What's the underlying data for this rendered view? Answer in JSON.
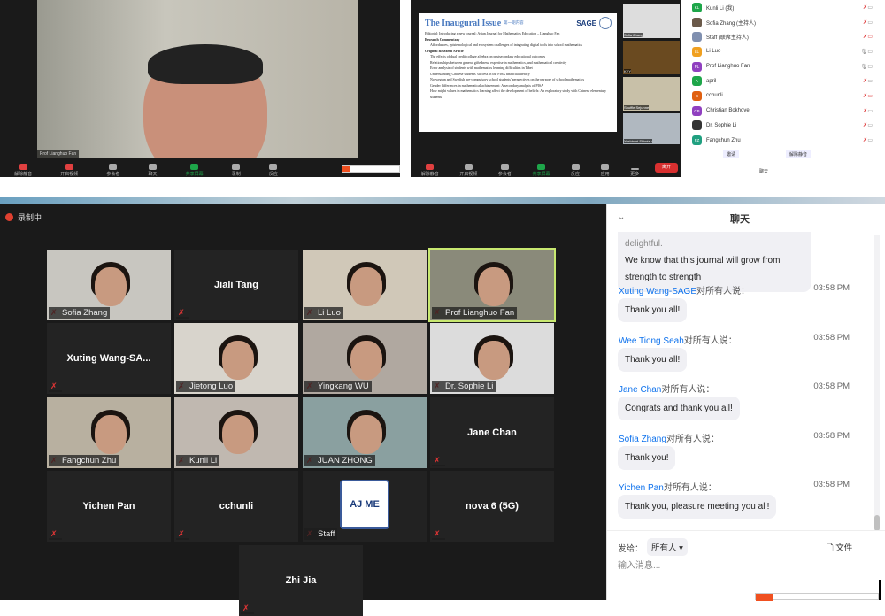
{
  "window1": {
    "speaker_label": "Prof Lianghuo Fan",
    "toolbar": [
      "解除静音",
      "开启视频",
      "参会者",
      "聊天",
      "共享屏幕",
      "录制",
      "反应"
    ],
    "participants_count": "10",
    "chat_badge": "1"
  },
  "window2": {
    "slide": {
      "title": "The Inaugural Issue",
      "title_cn": "第一期内容",
      "brand": "SAGE",
      "lines": [
        "Editorial: Introducing a new journal: Asian Journal for Mathematics Education – Lianghuo Fan",
        "Research Commentary",
        "Affordances, epistemological and ecosystem challenges of integrating digital tools into school mathematics",
        "Original Research Article",
        "The effects of dual credit college algebra on postsecondary educational outcomes",
        "Relationships between general giftedness, expertise in mathematics, and mathematical creativity",
        "Error analysis of students with mathematics learning difficulties in Tibet",
        "Understanding Chinese students' success in the PISA financial literacy",
        "Norwegian and Swedish pre-compulsory school students' perspectives on the purpose of school mathematics",
        "Gender differences in mathematical achievement: A secondary analysis of PISA",
        "How might values in mathematics learning affect the development of beliefs: An exploratory study with Chinese elementary students"
      ]
    },
    "thumbs": [
      "Sofia Zhang",
      "KYY",
      "Shuffle Sejunne",
      "Yoshinori Shimizu"
    ],
    "toolbar": [
      "解除静音",
      "开启视频",
      "参会者",
      "共享屏幕",
      "反应",
      "应用",
      "更多"
    ],
    "participants_count": "10",
    "leave_label": "离开",
    "participants": [
      {
        "initials": "KL",
        "name": "Kunli Li (我)",
        "color": "#1ea64a",
        "mic_muted": true,
        "cam_off": false
      },
      {
        "initials": "",
        "name": "Sofia Zhang (主持人)",
        "color": "#6b5a4a",
        "mic_muted": true,
        "cam_off": false
      },
      {
        "initials": "",
        "name": "Staff (联席主持人)",
        "color": "#8090b0",
        "mic_muted": true,
        "cam_off": true
      },
      {
        "initials": "LL",
        "name": "Li Luo",
        "color": "#f0a020",
        "mic_muted": false,
        "cam_off": false
      },
      {
        "initials": "PL",
        "name": "Prof Lianghuo Fan",
        "color": "#9040c0",
        "mic_muted": false,
        "cam_off": false
      },
      {
        "initials": "A",
        "name": "april",
        "color": "#1ea64a",
        "mic_muted": true,
        "cam_off": false
      },
      {
        "initials": "C",
        "name": "cchunli",
        "color": "#e06010",
        "mic_muted": true,
        "cam_off": true
      },
      {
        "initials": "CB",
        "name": "Christian Bokhove",
        "color": "#9040c0",
        "mic_muted": true,
        "cam_off": false
      },
      {
        "initials": "",
        "name": "Dr. Sophie Li",
        "color": "#333",
        "mic_muted": true,
        "cam_off": false
      },
      {
        "initials": "FZ",
        "name": "Fangchun Zhu",
        "color": "#20a080",
        "mic_muted": true,
        "cam_off": false
      }
    ],
    "invite_label": "邀请",
    "mute_all_label": "解除静音",
    "chat_section_label": "聊天"
  },
  "main": {
    "recording_label": "录制中",
    "tiles": [
      {
        "name": "Sofia Zhang",
        "video": true
      },
      {
        "name": "Jiali Tang",
        "video": false
      },
      {
        "name": "Li Luo",
        "video": true
      },
      {
        "name": "Prof Lianghuo Fan",
        "video": true,
        "active": true
      },
      {
        "name": "Xuting Wang-SA...",
        "video": false
      },
      {
        "name": "Jietong Luo",
        "video": true
      },
      {
        "name": "Yingkang WU",
        "video": true
      },
      {
        "name": "Dr. Sophie Li",
        "video": true
      },
      {
        "name": "Fangchun Zhu",
        "video": true
      },
      {
        "name": "Kunli  Li",
        "video": true
      },
      {
        "name": "JUAN  ZHONG",
        "video": true
      },
      {
        "name": "Jane Chan",
        "video": false
      },
      {
        "name": "Yichen Pan",
        "video": false
      },
      {
        "name": "cchunli",
        "video": false
      },
      {
        "name": "Staff",
        "video": true,
        "logo": "AJ ME"
      },
      {
        "name": "nova 6 (5G)",
        "video": false
      },
      {
        "name": "Zhi Jia",
        "video": false
      }
    ]
  },
  "chat": {
    "title": "聊天",
    "partial_message": "Congratulations everyone! This has been delightful.",
    "first_bubble": [
      "We know that this journal will grow from",
      "strength to strength"
    ],
    "to_all": "对所有人说：",
    "messages": [
      {
        "sender": "Xuting Wang-SAGE",
        "time": "03:58 PM",
        "text": "Thank you all!"
      },
      {
        "sender": "Wee Tiong Seah",
        "time": "03:58 PM",
        "text": "Thank you all!"
      },
      {
        "sender": "Jane Chan",
        "time": "03:58 PM",
        "text": "Congrats and thank you all!"
      },
      {
        "sender": "Sofia Zhang",
        "time": "03:58 PM",
        "text": "Thank you!"
      },
      {
        "sender": "Yichen Pan",
        "time": "03:58 PM",
        "text": "Thank you, pleasure meeting you all!"
      }
    ],
    "send_to_label": "发给：",
    "recipient": "所有人",
    "file_label": "文件",
    "input_placeholder": "输入消息..."
  }
}
